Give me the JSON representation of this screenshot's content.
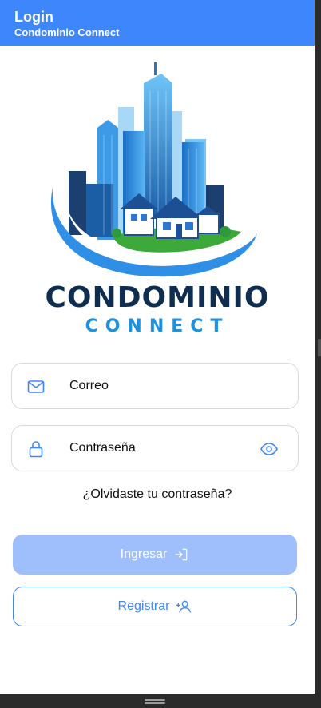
{
  "appbar": {
    "title": "Login",
    "subtitle": "Condominio Connect"
  },
  "logo": {
    "line1": "CONDOMINIO",
    "line2": "CONNECT"
  },
  "form": {
    "email": {
      "placeholder": "Correo",
      "value": "",
      "icon": "mail-icon"
    },
    "password": {
      "placeholder": "Contraseña",
      "value": "",
      "icon": "lock-icon",
      "toggle_icon": "eye-icon"
    },
    "forgot_label": "¿Olvidaste tu contraseña?"
  },
  "actions": {
    "login_label": "Ingresar",
    "login_icon": "login-icon",
    "register_label": "Registrar",
    "register_icon": "add-user-icon"
  },
  "colors": {
    "primary": "#3d86fb",
    "primary_disabled": "#9ebffb",
    "logo_navy": "#0f2d4e",
    "logo_blue": "#1e90e0"
  }
}
